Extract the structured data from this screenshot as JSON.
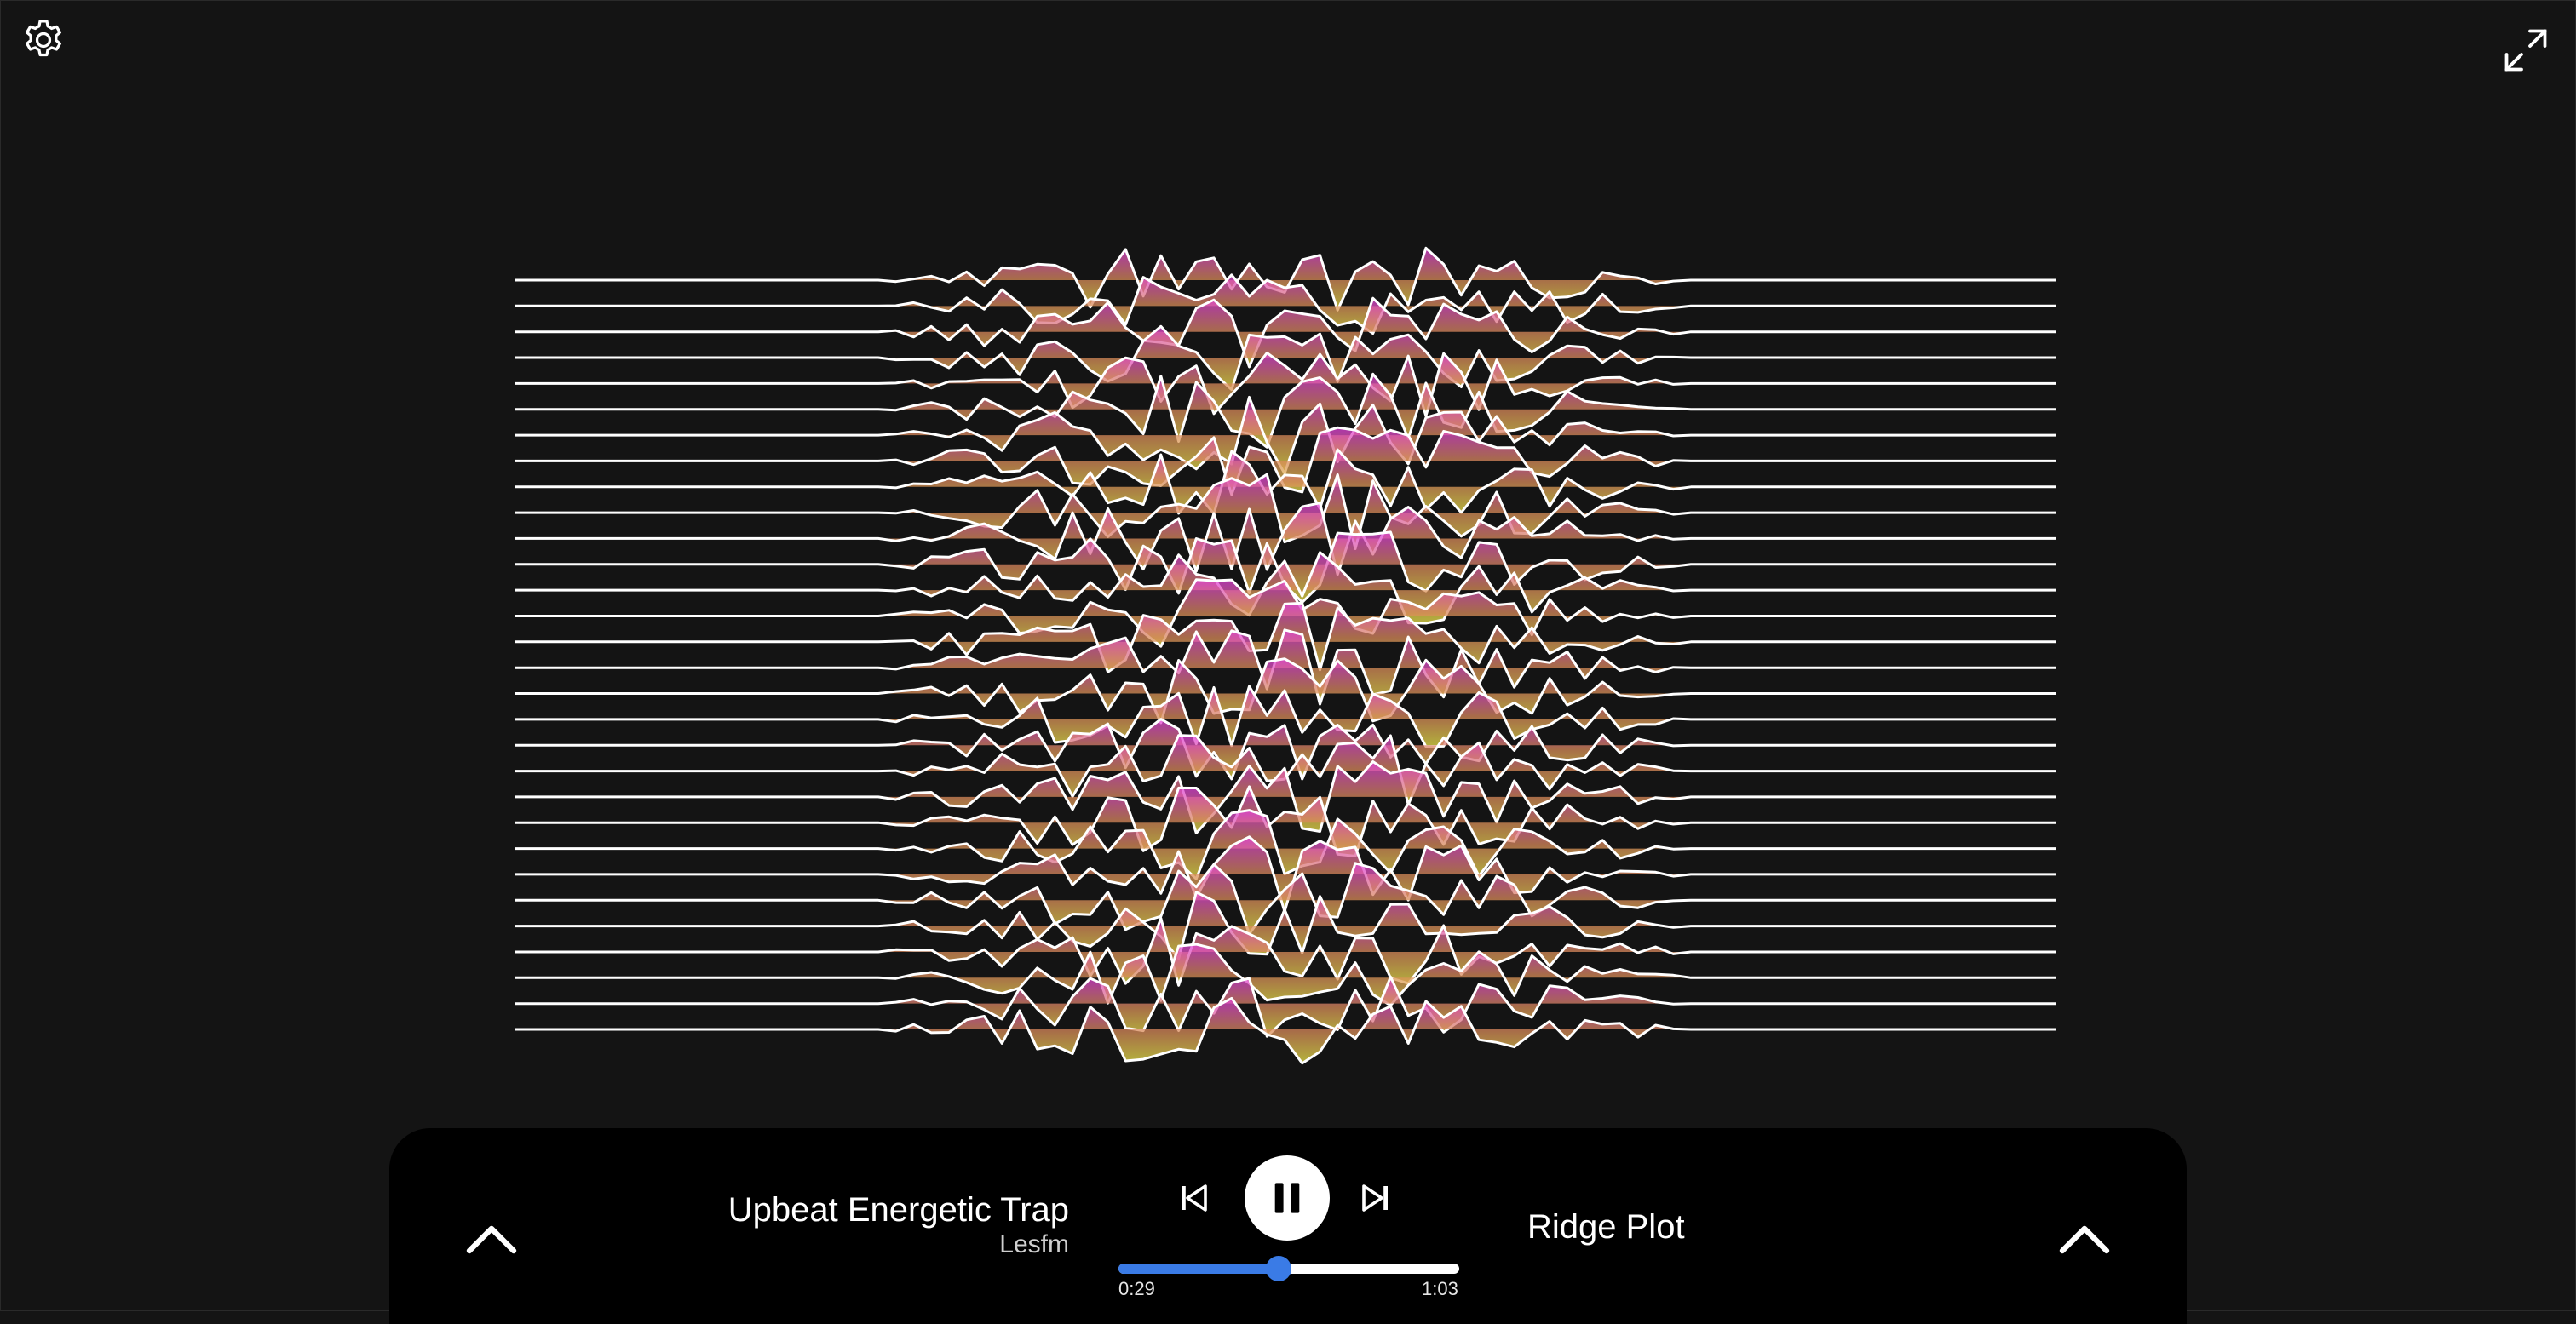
{
  "app": {
    "settings_icon": "gear-icon",
    "fullscreen_icon": "expand-icon"
  },
  "visualizer": {
    "name": "Ridge Plot",
    "ridge_count": 30,
    "gradient_top_color": "#e23fe0",
    "gradient_mid_color": "#d98a5a",
    "gradient_bottom_color": "#eae84a",
    "line_color": "#ffffff"
  },
  "player": {
    "collapse_left_icon": "chevron-up-icon",
    "collapse_right_icon": "chevron-up-icon",
    "track_title": "Upbeat Energetic Trap",
    "track_artist": "Lesfm",
    "prev_icon": "skip-previous-icon",
    "pause_icon": "pause-icon",
    "next_icon": "skip-next-icon",
    "current_time": "0:29",
    "total_time": "1:03",
    "progress_fraction": 0.47,
    "accent_color": "#3a7be6"
  }
}
